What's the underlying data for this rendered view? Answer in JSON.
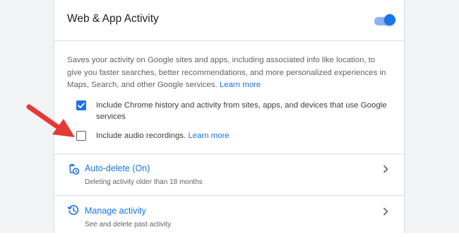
{
  "card": {
    "title": "Web & App Activity",
    "toggle_on": true,
    "description": "Saves your activity on Google sites and apps, including associated info like location, to give you faster searches, better recommendations, and more personalized experiences in Maps, Search, and other Google services.",
    "description_link": "Learn more"
  },
  "options": [
    {
      "label": "Include Chrome history and activity from sites, apps, and devices that use Google services",
      "checked": true
    },
    {
      "label": "Include audio recordings.",
      "link": "Learn more",
      "checked": false
    }
  ],
  "rows": [
    {
      "title": "Auto-delete (On)",
      "subtitle": "Deleting activity older than 18 months",
      "icon": "auto-delete-icon"
    },
    {
      "title": "Manage activity",
      "subtitle": "See and delete past activity",
      "icon": "history-icon"
    }
  ],
  "colors": {
    "accent": "#1a73e8",
    "arrow": "#e53935",
    "text": "#202124",
    "secondary_text": "#5f6368",
    "divider": "#dadce0",
    "background": "#f1f3f4"
  }
}
